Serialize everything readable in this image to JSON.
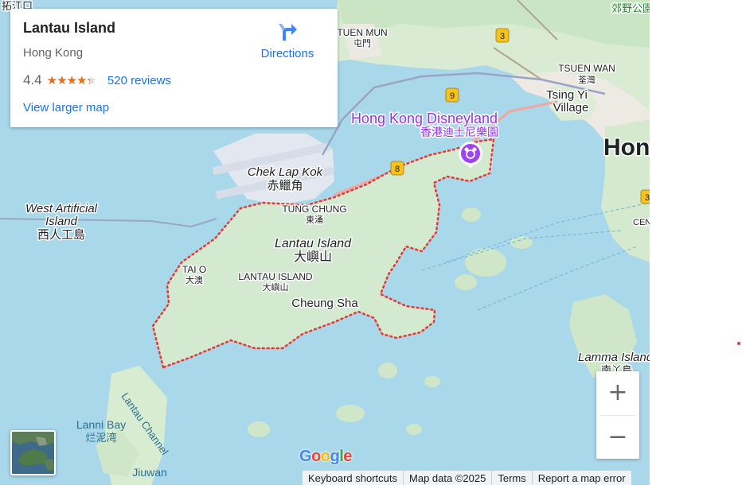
{
  "card": {
    "title": "Lantau Island",
    "subtitle": "Hong Kong",
    "rating": "4.4",
    "rating_fraction": 0.88,
    "stars_glyphs": "★★★★★",
    "reviews": "520 reviews",
    "larger_map": "View larger map",
    "directions": "Directions"
  },
  "map": {
    "labels": {
      "tuen_mun_en": "TUEN MUN",
      "tuen_mun_zh": "屯門",
      "tsuen_wan_en": "TSUEN WAN",
      "tsuen_wan_zh": "荃灣",
      "tsing_yi": "Tsing Yi",
      "tsing_yi_2": "Village",
      "hong_kong_partial": "Hon",
      "disneyland_en": "Hong Kong Disneyland",
      "disneyland_zh": "香港迪士尼樂園",
      "chek_lap_kok_en": "Chek Lap Kok",
      "chek_lap_kok_zh": "赤鱲角",
      "west_artificial_1": "West Artificial",
      "west_artificial_2": "Island",
      "west_artificial_zh": "西人工島",
      "tung_chung_en": "TUNG CHUNG",
      "tung_chung_zh": "東涌",
      "lantau_island_en": "Lantau Island",
      "lantau_island_zh": "大嶼山",
      "lantau_island_caps": "LANTAU ISLAND",
      "lantau_island_caps_zh": "大嶼山",
      "tai_o_en": "TAI O",
      "tai_o_zh": "大澳",
      "cheung_sha": "Cheung Sha",
      "lamma_island": "Lamma Island",
      "lamma_island_zh": "南丫島",
      "lanni_bay": "Lanni Bay",
      "lanni_bay_zh": "烂泥湾",
      "lantau_channel": "Lantau Channel",
      "jiuwan": "Jiuwan",
      "country_park_zh": "郊野公園",
      "top_left_zh": "拓江口",
      "central_partial": "CEN"
    },
    "route_shields": [
      "3",
      "9",
      "8",
      "3"
    ]
  },
  "controls": {
    "zoom_in": "+",
    "zoom_out": "−"
  },
  "footer": {
    "logo_letters": [
      "G",
      "o",
      "o",
      "g",
      "l",
      "e"
    ],
    "keyboard": "Keyboard shortcuts",
    "map_data": "Map data ©2025",
    "terms": "Terms",
    "report": "Report a map error"
  },
  "colors": {
    "water": "#a9d8ea",
    "land": "#e6efe2",
    "park": "#c7e5c5",
    "boundary": "#e53935",
    "link": "#1a73e8",
    "star": "#e7711b",
    "shield": "#f6c21e",
    "disney_pin": "#a142f4"
  },
  "icons": {
    "directions": "directions-arrow-icon",
    "pin": "attraction-pin-icon",
    "layers": "satellite-layer-thumbnail"
  }
}
